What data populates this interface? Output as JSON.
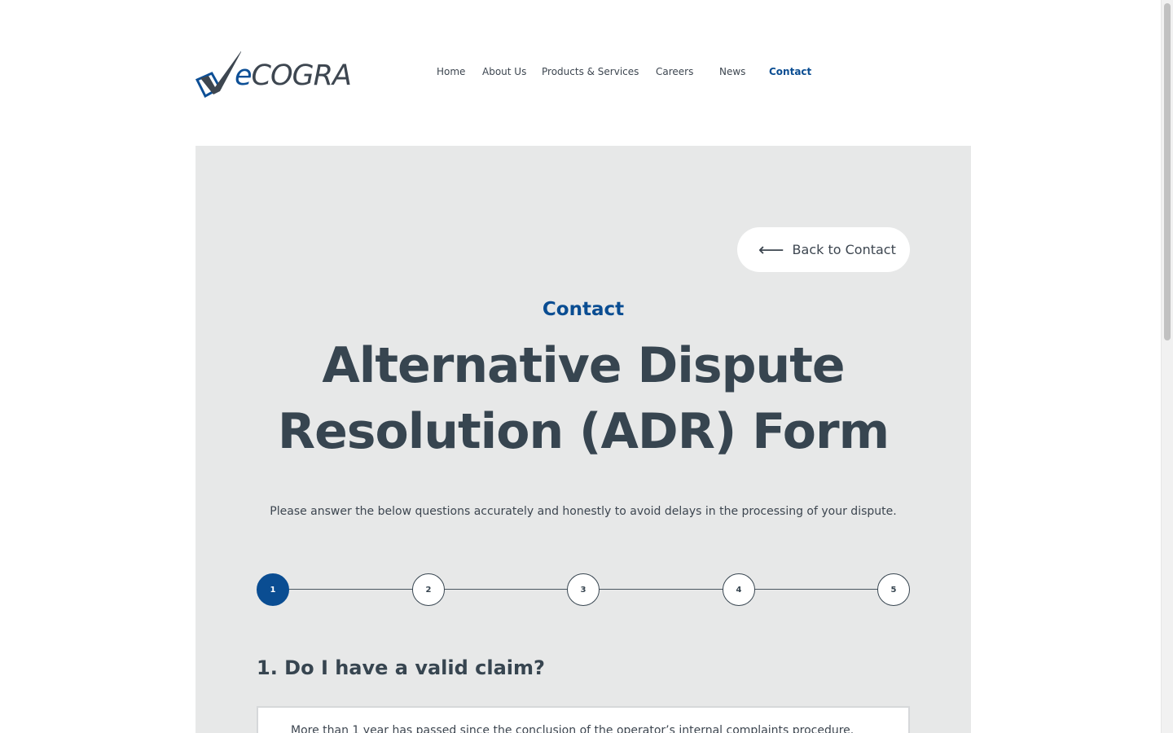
{
  "brand": {
    "logo_text_prefix": "e",
    "logo_text_main": "COGRA"
  },
  "nav": {
    "items": [
      {
        "label": "Home"
      },
      {
        "label": "About Us"
      },
      {
        "label": "Products & Services"
      },
      {
        "label": "Careers"
      },
      {
        "label": "News"
      },
      {
        "label": "Contact"
      }
    ],
    "active": "Contact"
  },
  "hero": {
    "back_label": "Back to Contact",
    "eyebrow": "Contact",
    "title": "Alternative Dispute Resolution (ADR) Form",
    "lede": "Please answer the below questions accurately and honestly to avoid delays in the processing of your dispute."
  },
  "stepper": {
    "steps": [
      "1",
      "2",
      "3",
      "4",
      "5"
    ],
    "current_step": 1
  },
  "form": {
    "question": "1. Do I have a valid claim?",
    "first_option": "More than 1 year has passed since the conclusion of the operator’s internal complaints procedure."
  },
  "colors": {
    "accent": "#0a4d92",
    "text": "#374550",
    "panel_bg": "#e7e8e8"
  },
  "icons": {
    "back": "arrow-left-icon",
    "logo_mark": "checkmark-icon"
  }
}
